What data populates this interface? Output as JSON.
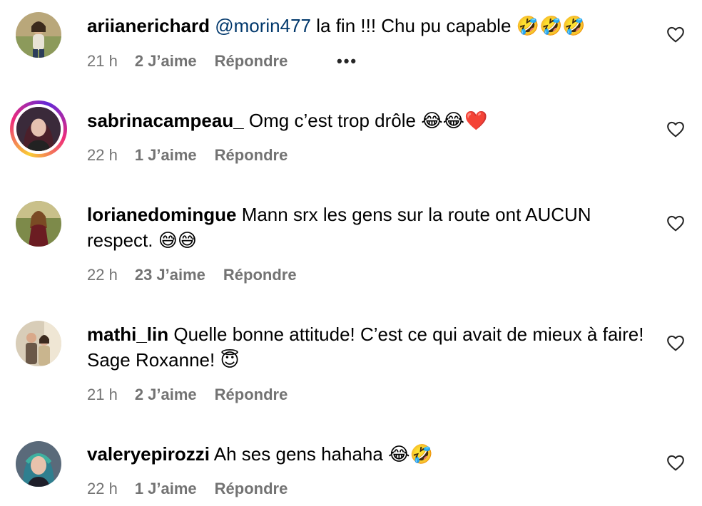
{
  "comments": [
    {
      "username": "ariianerichard",
      "mention": "@morin477",
      "text": " la fin !!! Chu pu capable 🤣🤣🤣",
      "time": "21 h",
      "likes": "2 J’aime",
      "reply": "Répondre",
      "more": "•••"
    },
    {
      "username": "sabrinacampeau_",
      "text": " Omg c’est trop drôle 😂😂❤️",
      "time": "22 h",
      "likes": "1 J’aime",
      "reply": "Répondre"
    },
    {
      "username": "lorianedomingue",
      "text": " Mann srx les gens sur la route ont AUCUN respect. 😅😅",
      "time": "22 h",
      "likes": "23 J’aime",
      "reply": "Répondre"
    },
    {
      "username": "mathi_lin",
      "text": " Quelle bonne attitude! C’est ce qui avait de mieux à faire! Sage Roxanne! 😇",
      "time": "21 h",
      "likes": "2 J’aime",
      "reply": "Répondre"
    },
    {
      "username": "valeryepirozzi",
      "text": " Ah ses gens hahaha 😂🤣",
      "time": "22 h",
      "likes": "1 J’aime",
      "reply": "Répondre"
    }
  ]
}
